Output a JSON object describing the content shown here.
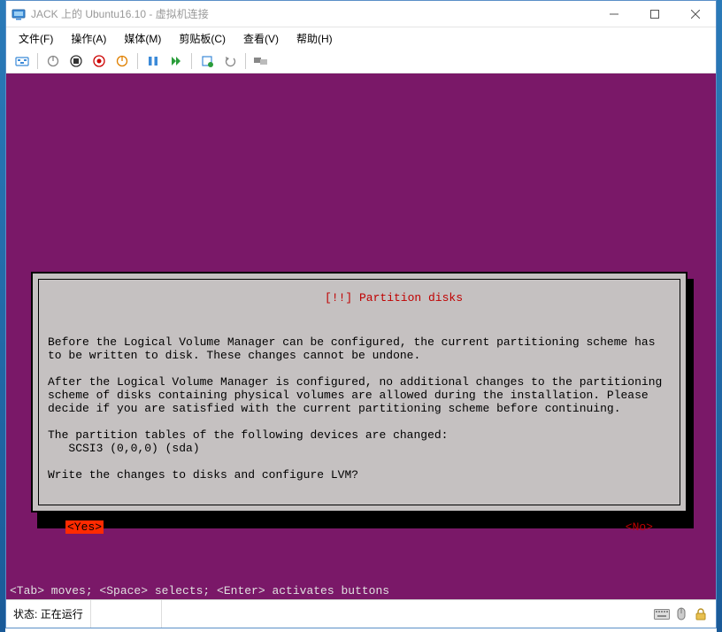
{
  "window": {
    "title": "JACK 上的 Ubuntu16.10 - 虚拟机连接"
  },
  "menu": {
    "file": "文件(F)",
    "action": "操作(A)",
    "media": "媒体(M)",
    "clipboard": "剪贴板(C)",
    "view": "查看(V)",
    "help": "帮助(H)"
  },
  "dialog": {
    "title": "[!!] Partition disks",
    "para1": "Before the Logical Volume Manager can be configured, the current partitioning scheme has to be written to disk. These changes cannot be undone.",
    "para2": "After the Logical Volume Manager is configured, no additional changes to the partitioning scheme of disks containing physical volumes are allowed during the installation. Please decide if you are satisfied with the current partitioning scheme before continuing.",
    "para3": "The partition tables of the following devices are changed:",
    "device": "   SCSI3 (0,0,0) (sda)",
    "question": "Write the changes to disks and configure LVM?",
    "yes": "<Yes>",
    "no": "<No>"
  },
  "vm_footer": "<Tab> moves; <Space> selects; <Enter> activates buttons",
  "status": {
    "label": "状态:",
    "value": "正在运行"
  }
}
